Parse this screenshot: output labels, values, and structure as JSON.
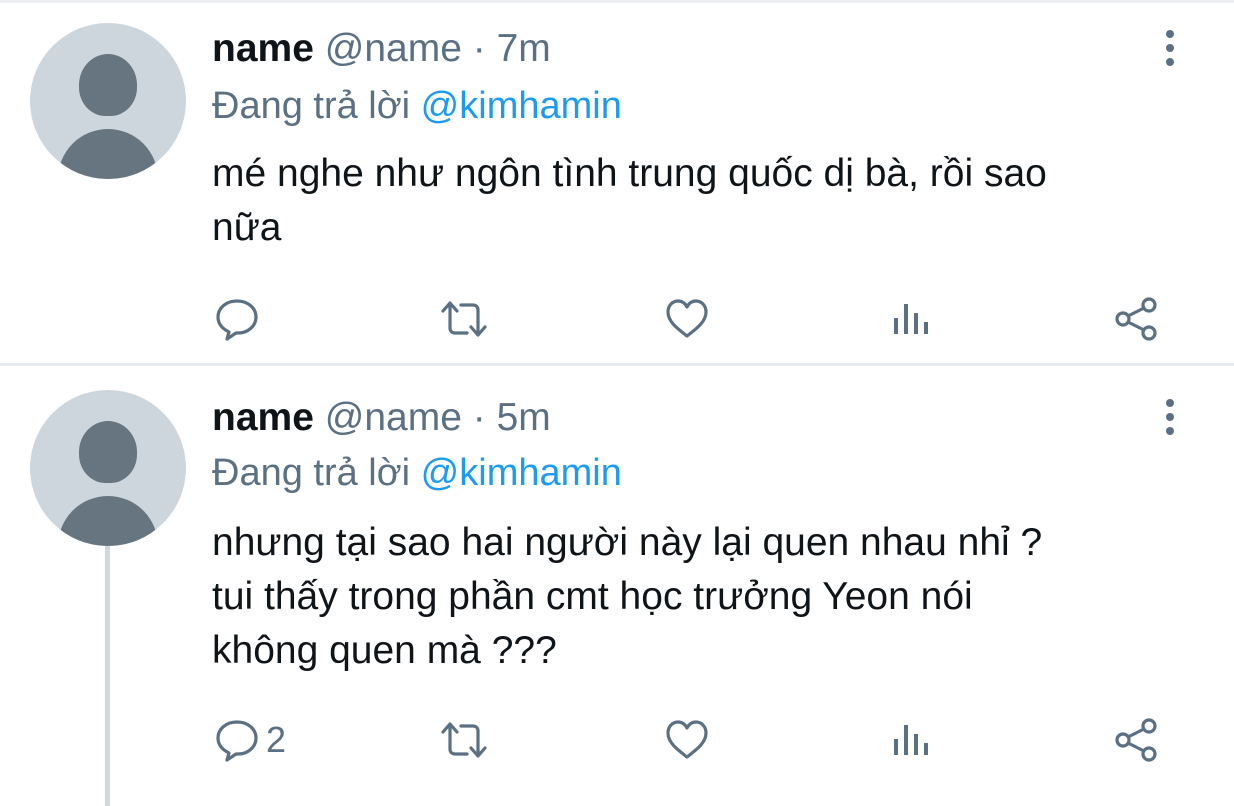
{
  "tweets": [
    {
      "name": "name",
      "handle": "@name",
      "separator": "·",
      "time": "7m",
      "replying_label": "Đang trả lời",
      "replying_to": "@kimhamin",
      "text": "mé nghe như ngôn tình trung quốc dị bà, rồi sao\nnữa",
      "reply_count": "",
      "icons": [
        "reply-icon",
        "retweet-icon",
        "like-icon",
        "analytics-icon",
        "share-icon",
        "more-icon",
        "avatar-icon"
      ]
    },
    {
      "name": "name",
      "handle": "@name",
      "separator": "·",
      "time": "5m",
      "replying_label": "Đang trả lời",
      "replying_to": "@kimhamin",
      "text": "nhưng tại sao hai người này lại quen nhau nhỉ ?\ntui thấy trong phần cmt học trưởng Yeon nói\nkhông quen mà ???",
      "reply_count": "2",
      "icons": [
        "reply-icon",
        "retweet-icon",
        "like-icon",
        "analytics-icon",
        "share-icon",
        "more-icon",
        "avatar-icon"
      ]
    }
  ],
  "colors": {
    "text": "#0f1419",
    "secondary": "#5b7083",
    "mention": "#1d9bf0",
    "avatar_bg": "#cdd6dd",
    "avatar_fg": "#66757f",
    "divider": "#e6ecf0"
  }
}
